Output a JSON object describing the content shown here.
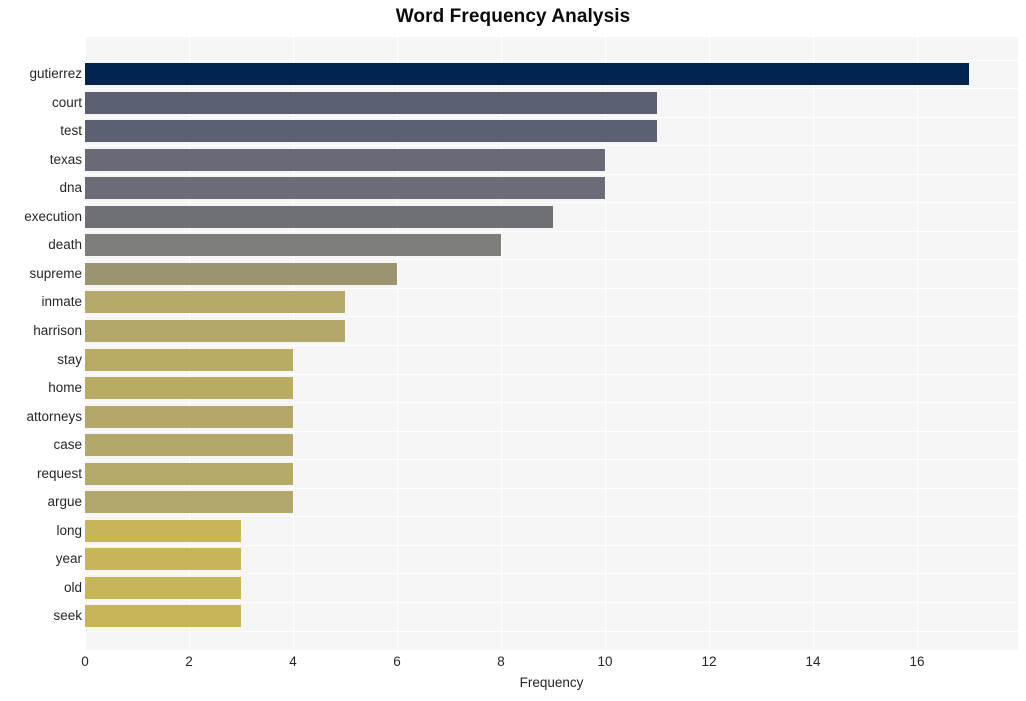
{
  "chart_data": {
    "type": "bar",
    "orientation": "horizontal",
    "title": "Word Frequency Analysis",
    "xlabel": "Frequency",
    "ylabel": "",
    "xlim": [
      0,
      17.9
    ],
    "xticks": [
      0,
      2,
      4,
      6,
      8,
      10,
      12,
      14,
      16
    ],
    "grid": true,
    "legend": false,
    "categories": [
      "gutierrez",
      "court",
      "test",
      "texas",
      "dna",
      "execution",
      "death",
      "supreme",
      "inmate",
      "harrison",
      "stay",
      "home",
      "attorneys",
      "case",
      "request",
      "argue",
      "long",
      "year",
      "old",
      "seek"
    ],
    "values": [
      17,
      11,
      11,
      10,
      10,
      9,
      8,
      6,
      5,
      5,
      4,
      4,
      4,
      4,
      4,
      4,
      3,
      3,
      3,
      3
    ],
    "bar_colors": [
      "#042450",
      "#5b6070",
      "#5c6171",
      "#686b75",
      "#6a6d77",
      "#6f7076",
      "#7d7d79",
      "#9c9470",
      "#b4a969",
      "#b3a86a",
      "#b8ab64",
      "#b8ab64",
      "#b3a86a",
      "#b3a86a",
      "#b5a968",
      "#b2a76c",
      "#c6b657",
      "#c6b657",
      "#c6b657",
      "#c6b657"
    ],
    "plot_background": "#f5f5f6",
    "gridline_color": "#ffffff",
    "title_color": "#0a0a0a",
    "tick_label_color": "#262626"
  }
}
